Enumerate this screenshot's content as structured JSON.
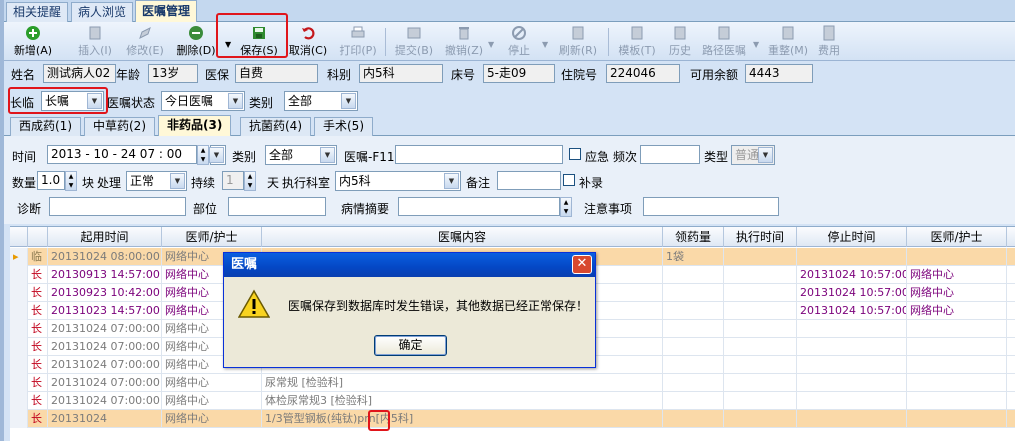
{
  "top_tabs": [
    "相关提醒",
    "病人浏览",
    "医嘱管理"
  ],
  "toolbar": {
    "add": "新增(A)",
    "insert": "插入(I)",
    "edit": "修改(E)",
    "delete": "删除(D)",
    "save": "保存(S)",
    "cancel": "取消(C)",
    "print": "打印(P)",
    "submit": "提交(B)",
    "revoke": "撤销(Z)",
    "stop": "停止",
    "refresh": "刷新(R)",
    "template": "模板(T)",
    "history": "历史",
    "pathway": "路径医嘱",
    "reset": "重整(M)",
    "fee": "费用"
  },
  "patient": {
    "name_label": "姓名",
    "name": "测试病人02",
    "age_label": "年龄",
    "age": "13岁",
    "insurance_label": "医保",
    "insurance": "自费",
    "dept_label": "科别",
    "dept": "内5科",
    "bed_label": "床号",
    "bed": "5-走09",
    "admission_label": "住院号",
    "admission": "224046",
    "balance_label": "可用余额",
    "balance": "4443"
  },
  "filter": {
    "long_temp_label": "长临",
    "long_temp": "长嘱",
    "status_label": "医嘱状态",
    "status": "今日医嘱",
    "category_label": "类别",
    "category": "全部"
  },
  "sub_tabs": [
    "西成药(1)",
    "中草药(2)",
    "非药品(3)",
    "抗菌药(4)",
    "手术(5)"
  ],
  "form": {
    "time_label": "时间",
    "time": "2013 - 10 - 24    07 : 00",
    "type_label": "类别",
    "type": "全部",
    "order_label": "医嘱-F11",
    "order": "",
    "urgent_label": "应急",
    "freq_label": "频次",
    "freq": "",
    "kind_label": "类型",
    "kind": "普通",
    "qty_label": "数量",
    "qty": "1.0",
    "unit": "块",
    "handle_label": "处理",
    "handle": "正常",
    "duration_label": "持续",
    "duration": "1",
    "day": "天",
    "exec_dept_label": "执行科室",
    "exec_dept": "内5科",
    "remark_label": "备注",
    "remark": "",
    "makeup_label": "补录",
    "diagnosis_label": "诊断",
    "site_label": "部位",
    "summary_label": "病情摘要",
    "notice_label": "注意事项"
  },
  "grid": {
    "headers": [
      "起用时间",
      "医师/护士",
      "医嘱内容",
      "领药量",
      "执行时间",
      "停止时间",
      "医师/护士"
    ],
    "rows": [
      {
        "type": "临",
        "start": "20131024 08:00:00",
        "doctor": "网络中心",
        "content": "",
        "qty": "1袋",
        "exec": "",
        "stop": "",
        "stop_doctor": "",
        "style": "selected"
      },
      {
        "type": "长",
        "start": "20130913 14:57:00",
        "doctor": "网络中心",
        "content": "",
        "qty": "",
        "exec": "",
        "stop": "20131024 10:57:00",
        "stop_doctor": "网络中心",
        "style": "purple"
      },
      {
        "type": "长",
        "start": "20130923 10:42:00",
        "doctor": "网络中心",
        "content": "",
        "qty": "",
        "exec": "",
        "stop": "20131024 10:57:00",
        "stop_doctor": "网络中心",
        "style": "purple"
      },
      {
        "type": "长",
        "start": "20131023 14:57:00",
        "doctor": "网络中心",
        "content": "",
        "qty": "",
        "exec": "",
        "stop": "20131024 10:57:00",
        "stop_doctor": "网络中心",
        "style": "purple"
      },
      {
        "type": "长",
        "start": "20131024 07:00:00",
        "doctor": "网络中心",
        "content": "",
        "qty": "",
        "exec": "",
        "stop": "",
        "stop_doctor": "",
        "style": "grey"
      },
      {
        "type": "长",
        "start": "20131024 07:00:00",
        "doctor": "网络中心",
        "content": "",
        "qty": "",
        "exec": "",
        "stop": "",
        "stop_doctor": "",
        "style": "grey"
      },
      {
        "type": "长",
        "start": "20131024 07:00:00",
        "doctor": "网络中心",
        "content": "",
        "qty": "",
        "exec": "",
        "stop": "",
        "stop_doctor": "",
        "style": "grey"
      },
      {
        "type": "长",
        "start": "20131024 07:00:00",
        "doctor": "网络中心",
        "content": "尿常规    [检验科]",
        "qty": "",
        "exec": "",
        "stop": "",
        "stop_doctor": "",
        "style": "grey"
      },
      {
        "type": "长",
        "start": "20131024 07:00:00",
        "doctor": "网络中心",
        "content": "体检尿常规3    [检验科]",
        "qty": "",
        "exec": "",
        "stop": "",
        "stop_doctor": "",
        "style": "grey"
      },
      {
        "type": "长",
        "start": "20131024",
        "doctor": "网络中心",
        "content": "1/3管型钢板(纯钛)prn[内5科]",
        "qty": "",
        "exec": "",
        "stop": "",
        "stop_doctor": "",
        "style": "selected"
      }
    ]
  },
  "dialog": {
    "title": "医嘱",
    "message": "医嘱保存到数据库时发生错误，其他数据已经正常保存！",
    "ok": "确定"
  },
  "colors": {
    "highlight_red": "#e0151b",
    "long_order": "#c0001a",
    "selected_row": "#fad9a8"
  }
}
